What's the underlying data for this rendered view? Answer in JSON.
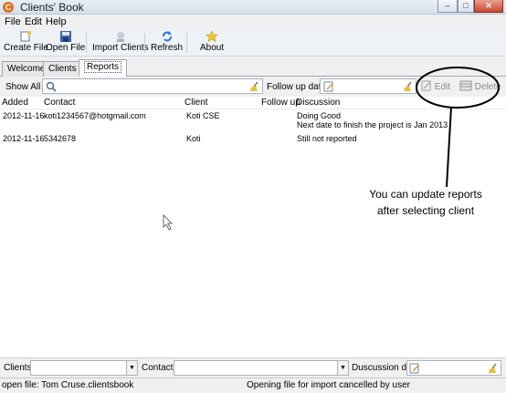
{
  "window": {
    "title": "Clients' Book",
    "app_icon": "C"
  },
  "menu": [
    "File",
    "Edit",
    "Help"
  ],
  "toolbar": {
    "create_file": "Create File",
    "open_file": "Open File",
    "import_clients": "Import Clients",
    "refresh": "Refresh",
    "about": "About"
  },
  "tabs": [
    "Welcome",
    "Clients",
    "Reports"
  ],
  "filter": {
    "show_all": "Show All",
    "search_value": "",
    "follow_up_label": "Follow up date",
    "follow_up_value": "",
    "edit_label": "Edit",
    "delete_label": "Delete"
  },
  "grid": {
    "columns": [
      "Added",
      "Contact",
      "Client",
      "Follow up",
      "Discussion"
    ],
    "rows": [
      {
        "added": "2012-11-16",
        "contact": "koti1234567@hotgmail.com",
        "client": "Koti CSE",
        "follow_up": "",
        "discussion_1": "Doing Good",
        "discussion_2": "Next date to finish the project is Jan 2013"
      },
      {
        "added": "2012-11-16",
        "contact": "5342678",
        "client": "Koti",
        "follow_up": "",
        "discussion_1": "Still not reported",
        "discussion_2": ""
      }
    ]
  },
  "annotation": {
    "line1": "You can update reports",
    "line2": "after selecting client"
  },
  "bottom": {
    "clients_label": "Clients",
    "clients_value": "",
    "contacts_label": "Contacts",
    "contacts_value": "",
    "discussion_date_label": "Duscussion date",
    "discussion_date_value": ""
  },
  "status": {
    "left": "open file: Tom Cruse.clientsbook",
    "right": "Opening file for import cancelled by user"
  },
  "colors": {
    "accent": "#e07020",
    "annotation_ink": "#000000"
  }
}
